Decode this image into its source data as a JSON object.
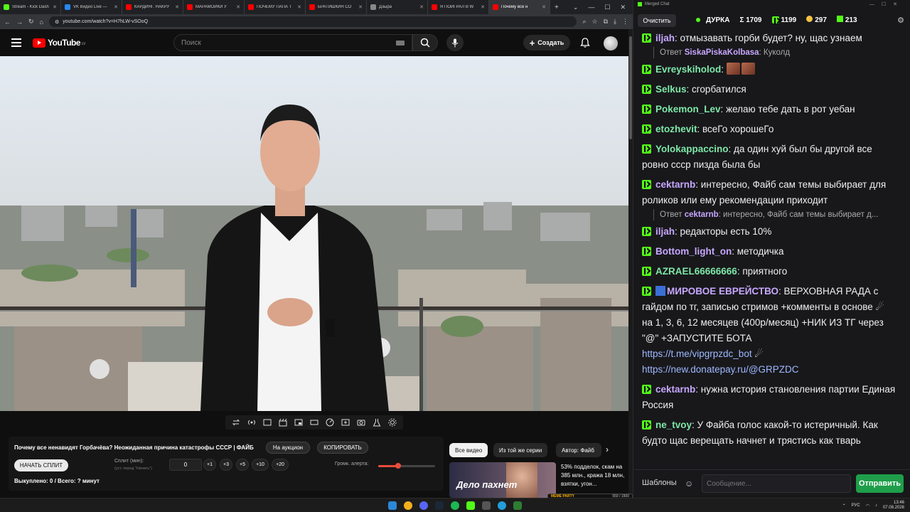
{
  "browser": {
    "tabs": [
      {
        "label": "Stream - Kick Dash",
        "color": "#53fc18"
      },
      {
        "label": "VK Видео Live —",
        "color": "#2787f5"
      },
      {
        "label": "КАРДИНГ. НАКРУ",
        "color": "#ff0000"
      },
      {
        "label": "МАРАМОЙКИ У",
        "color": "#ff0000"
      },
      {
        "label": "ПОЧЕМУ ПАПА Т",
        "color": "#ff0000"
      },
      {
        "label": "БРАТИШКИН СО",
        "color": "#ff0000"
      },
      {
        "label": "Дзыра",
        "color": "#888888"
      },
      {
        "label": "Я ПОИГРАЛ В W",
        "color": "#ff0000"
      },
      {
        "label": "Почему все н",
        "color": "#ff0000"
      }
    ],
    "new_tab": "+",
    "url": "youtube.com/watch?v=H7hLW-vSOoQ"
  },
  "youtube": {
    "logo_text": "YouTube",
    "logo_region": "LV",
    "search_placeholder": "Поиск",
    "create_label": "Создать"
  },
  "video_panel": {
    "title": "Почему все ненавидят Горбачёва? Неожиданная причина катастрофы СССР | ФАЙБ",
    "auction_label": "На аукцион",
    "copy_label": "КОПИРОВАТЬ",
    "start_split_label": "НАЧАТЬ СПЛИТ",
    "split_label": "Сплит (мин):",
    "split_hint": "(уст. перед \"Начать\")",
    "split_value": "0",
    "increments": [
      "+1",
      "+3",
      "+5",
      "+10",
      "+20"
    ],
    "alert_volume_label": "Громк. алерта:",
    "alert_volume_fraction": 0.35,
    "bought_text": "Выкуплено: 0 / Всего: ? минут"
  },
  "recommendations": {
    "chips": [
      "Все видео",
      "Из той же серии",
      "Автор: Файб"
    ],
    "thumb_text": "Дело пахнет",
    "first_title": "53% подделок, скам на 385 млн., кража 18 млн, взятки, угон..."
  },
  "overlay": {
    "meme_party_label": "MEME PARTY",
    "meme_party_progress": "550 / 1500"
  },
  "chat": {
    "window_title": "Merged Chat",
    "clear_label": "Очистить",
    "channel_name": "ДУРКА",
    "total": "Σ 1709",
    "kick_count": "1199",
    "other_count": "297",
    "vk_count": "213",
    "messages": [
      {
        "user": "iljah",
        "color": "#c7a7ff",
        "text": "отмызавать горби будет? ну, щас узнаем"
      },
      {
        "user": "Evreyskiholod",
        "color": "#7ee8a8",
        "text": ""
      },
      {
        "user": "Selkus",
        "color": "#7ee8a8",
        "text": "сгорбатился"
      },
      {
        "user": "Pokemon_Lev",
        "color": "#7ee8a8",
        "text": "желаю тебе дать в рот уебан"
      },
      {
        "user": "etozhevit",
        "color": "#7ee8a8",
        "text": "всеГо хорошеГо"
      },
      {
        "user": "Yolokappaccino",
        "color": "#7ee8a8",
        "text": "да один хуй был бы другой все ровно ссср пизда была бы"
      },
      {
        "user": "cektarnb",
        "color": "#c7a7ff",
        "text": "интересно, Файб сам темы выбирает для роликов или ему рекомендации приходит"
      },
      {
        "user": "iljah",
        "color": "#c7a7ff",
        "text": "редакторы есть 10%"
      },
      {
        "user": "Bottom_light_on",
        "color": "#c7a7ff",
        "text": "методичка"
      },
      {
        "user": "AZRAEL66666666",
        "color": "#7ee8a8",
        "text": "приятного"
      },
      {
        "user": "МИРОВОЕ ЕВРЕЙСТВО",
        "color": "#c7a7ff",
        "text": "ВЕРХОВНАЯ РАДА с гайдом по тг, записью стримов +комменты в основе ☄ на 1, 3, 6, 12 месяцев (400р/месяц) +НИК ИЗ ТГ через \"@\" +ЗАПУСТИТЕ БОТА"
      },
      {
        "user": "cektarnb",
        "color": "#c7a7ff",
        "text": "нужна история становления партии Единая Россия"
      },
      {
        "user": "ne_tvoy",
        "color": "#7ee8a8",
        "text": "У Файба голос какой-то истеричный. Как будто щас верещать начнет и трястись как тварь"
      }
    ],
    "reply1_prefix": "Ответ",
    "reply1_user": "SiskaPiskaKolbasa",
    "reply1_text": "Куколд",
    "reply2_prefix": "Ответ",
    "reply2_user": "cektarnb",
    "reply2_text": "интересно, Файб сам темы выбирает д...",
    "link1": "https://t.me/vipgrpzdc_bot",
    "link2": "https://new.donatepay.ru/@GRPZDC",
    "templates_label": "Шаблоны",
    "input_placeholder": "Сообщение...",
    "send_label": "Отправить"
  },
  "taskbar": {
    "lang": "РУС",
    "time": "13:46",
    "date": "07.08.2026"
  }
}
